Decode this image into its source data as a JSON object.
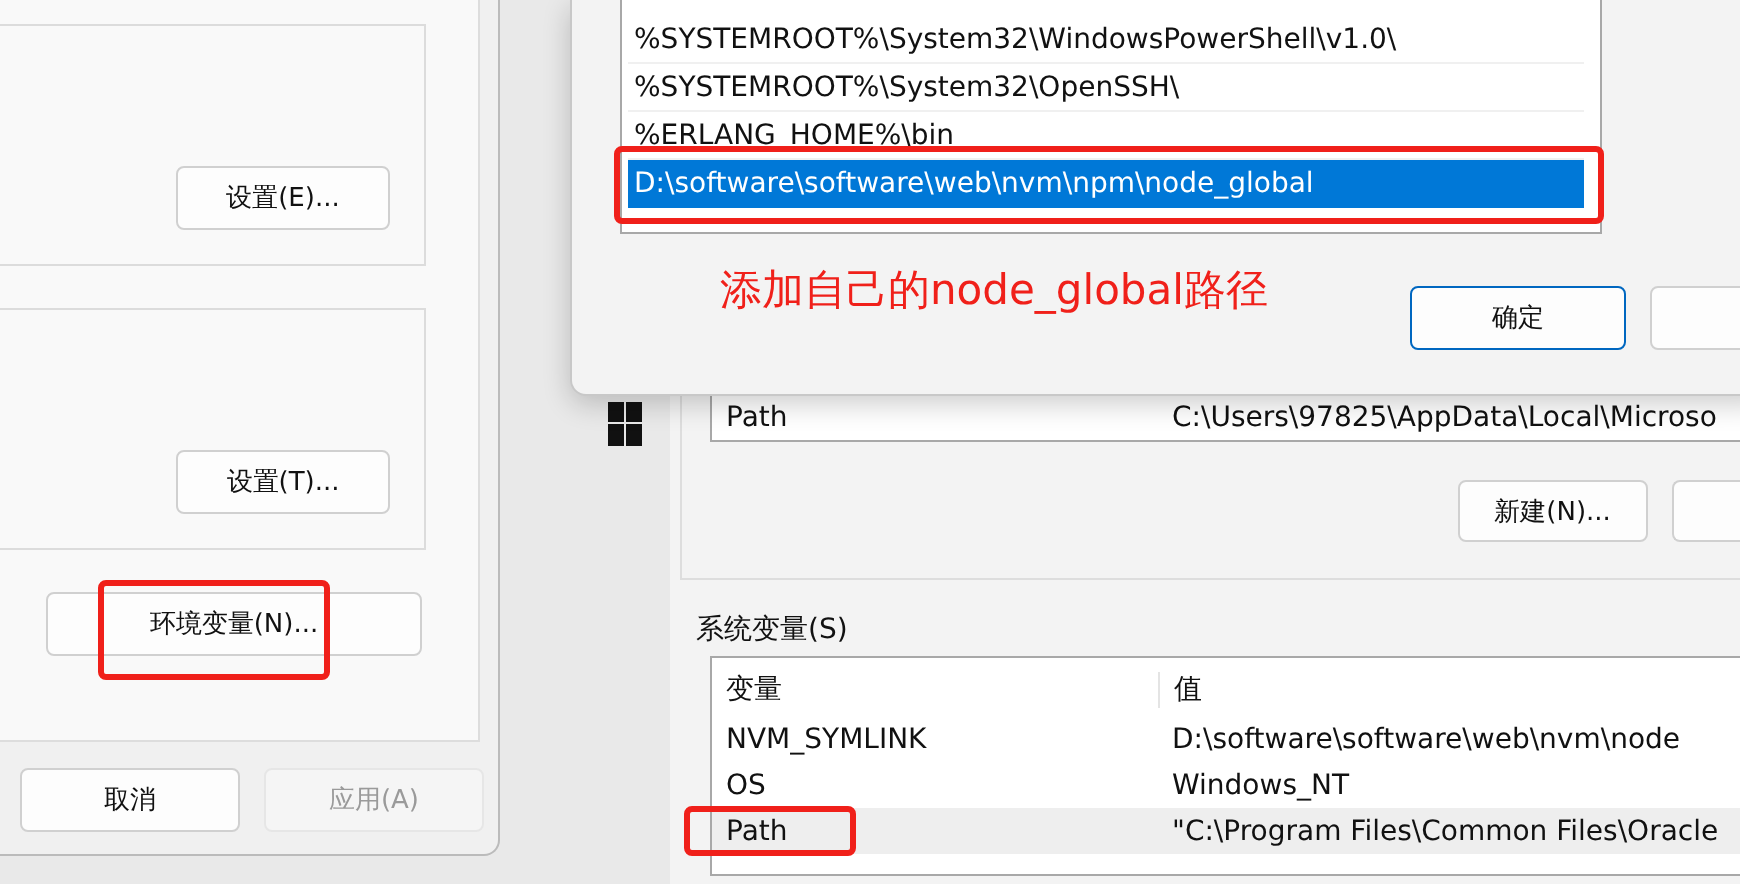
{
  "system_properties": {
    "groups": [
      {
        "button": "设置(E)..."
      },
      {
        "button": "设置(T)..."
      }
    ],
    "env_button": {
      "label": "环境变量(N)...",
      "annotated": true
    },
    "footer_buttons": [
      {
        "label": "取消",
        "disabled": false
      },
      {
        "label": "应用(A)",
        "disabled": true
      }
    ]
  },
  "environment_variables": {
    "user_rows": [
      {
        "name": "Path",
        "value": "C:\\Users\\97825\\AppData\\Local\\Microso"
      }
    ],
    "new_button": "新建(N)...",
    "system_title": "系统变量(S)",
    "system_columns": [
      "变量",
      "值"
    ],
    "system_rows": [
      {
        "name": "NVM_SYMLINK",
        "value": "D:\\software\\software\\web\\nvm\\node",
        "selected": false,
        "annotated": false
      },
      {
        "name": "OS",
        "value": "Windows_NT",
        "selected": false,
        "annotated": false
      },
      {
        "name": "Path",
        "value": "\"C:\\Program Files\\Common Files\\Oracle",
        "selected": true,
        "annotated": true
      }
    ]
  },
  "edit_dialog": {
    "entries": [
      {
        "text": "%SYSTEMROOT%\\System32\\WindowsPowerShell\\v1.0\\",
        "selected": false,
        "annotated": false
      },
      {
        "text": "%SYSTEMROOT%\\System32\\OpenSSH\\",
        "selected": false,
        "annotated": false
      },
      {
        "text": "%ERLANG_HOME%\\bin",
        "selected": false,
        "annotated": false
      },
      {
        "text": "D:\\software\\software\\web\\nvm\\npm\\node_global",
        "selected": true,
        "annotated": true
      }
    ],
    "annotation_note": "添加自己的node_global路径",
    "ok_button": "确定"
  }
}
